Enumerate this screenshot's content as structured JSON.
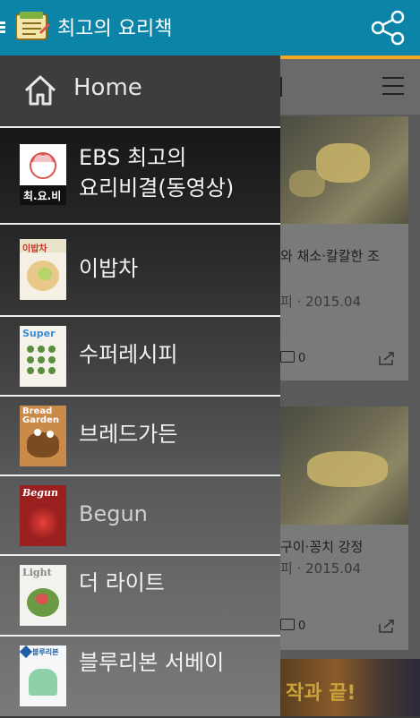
{
  "app": {
    "title": "최고의 요리책",
    "colors": {
      "header": "#0b84a8",
      "accent": "#f5a623"
    },
    "share_icon": "share-icon",
    "logo_icon": "recipe-book-icon"
  },
  "drawer": {
    "home_label": "Home",
    "home_icon": "home-icon",
    "items": [
      {
        "label_line1": "EBS 최고의",
        "label_line2": "요리비결(동영상)",
        "thumb_text": "최.요.비"
      },
      {
        "label": "이밥차",
        "thumb_text": "이밥차"
      },
      {
        "label": "수퍼레시피",
        "thumb_text": "Super"
      },
      {
        "label": "브레드가든",
        "thumb_text": "Bread Garden"
      },
      {
        "label": "Begun",
        "thumb_text": "Begun"
      },
      {
        "label": "더 라이트",
        "thumb_text": "Light"
      },
      {
        "label": "블루리본 서베이",
        "thumb_text": "블루리본"
      }
    ]
  },
  "background": {
    "menu_icon": "hamburger-menu-icon",
    "cards": [
      {
        "title": "와 채소·칼칼한 조",
        "meta": "피 · 2015.04",
        "comments": "0"
      },
      {
        "title": "구이·꽁치 강정",
        "meta": "피 · 2015.04",
        "comments": "0"
      }
    ],
    "ad_text": "작과 끝!"
  }
}
